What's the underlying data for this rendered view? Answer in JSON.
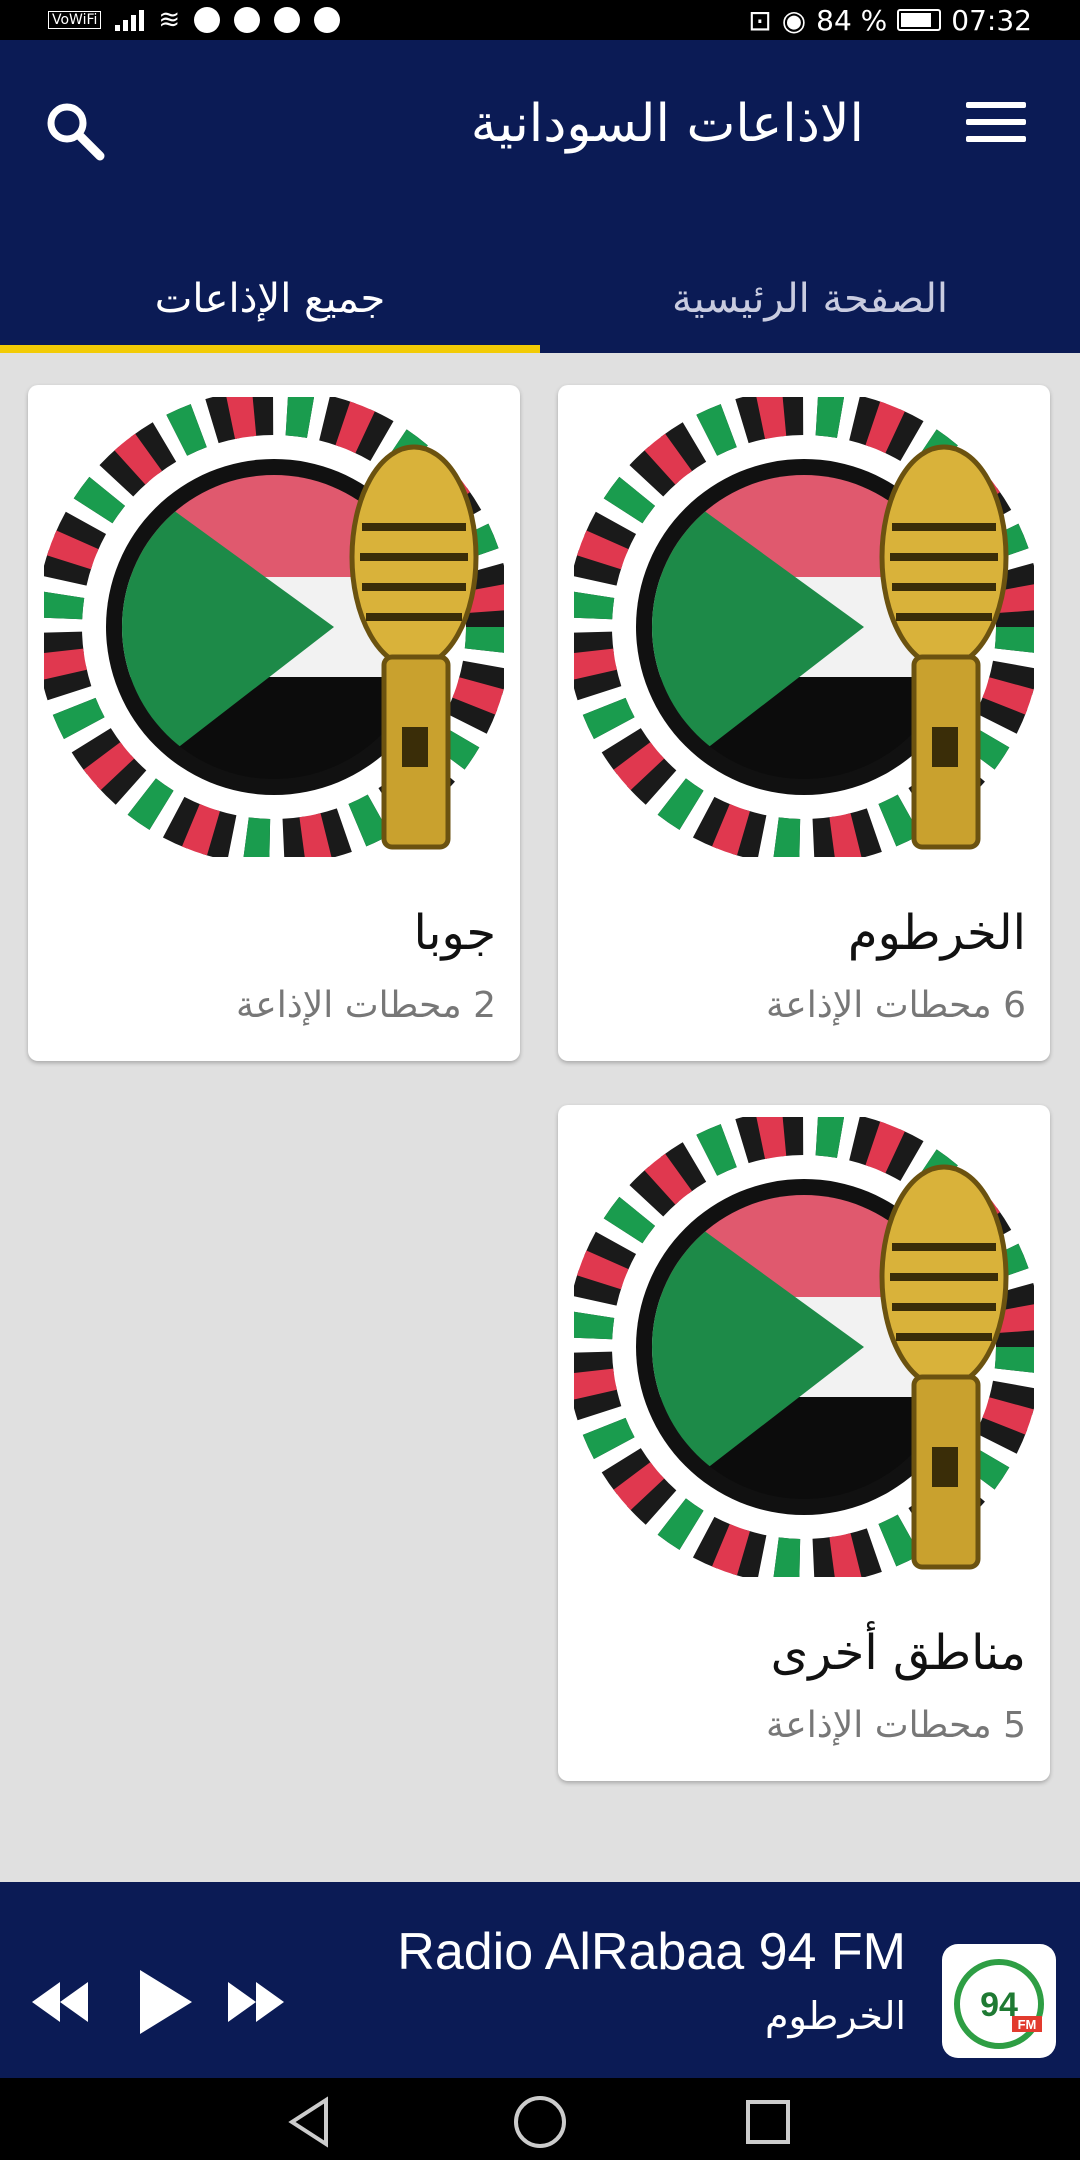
{
  "status_bar": {
    "carrier_badge": "VoWiFi",
    "battery": "84 %",
    "time": "07:32"
  },
  "app_bar": {
    "title": "الاذاعات السودانية",
    "menu_icon": "hamburger-menu-icon",
    "search_icon": "search-icon"
  },
  "tabs": [
    {
      "label": "الصفحة الرئيسية",
      "selected": false
    },
    {
      "label": "جميع الإذاعات",
      "selected": true
    }
  ],
  "colors": {
    "primary": "#0b1b55",
    "tab_indicator": "#f2cb05",
    "background": "#e0e0e0"
  },
  "regions": [
    {
      "name": "الخرطوم",
      "count": "6 محطات الإذاعة"
    },
    {
      "name": "جوبا",
      "count": "2 محطات الإذاعة"
    },
    {
      "name": "مناطق أخرى",
      "count": "5 محطات الإذاعة"
    }
  ],
  "player": {
    "station": "Radio AlRabaa 94 FM",
    "city": "الخرطوم",
    "logo_text": "94",
    "logo_badge": "FM",
    "controls": [
      "rewind-icon",
      "play-icon",
      "fast-forward-icon"
    ]
  },
  "nav_bar": [
    "back-icon",
    "home-icon",
    "recents-icon"
  ]
}
